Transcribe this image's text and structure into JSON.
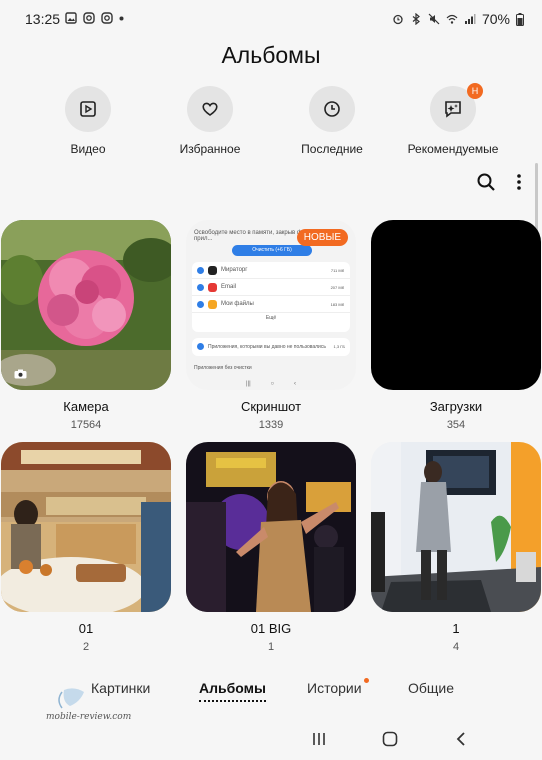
{
  "status_bar": {
    "time": "13:25",
    "battery": "70%"
  },
  "title": "Альбомы",
  "quick_access": [
    {
      "label": "Видео",
      "icon": "video-icon"
    },
    {
      "label": "Избранное",
      "icon": "heart-icon"
    },
    {
      "label": "Последние",
      "icon": "clock-icon"
    },
    {
      "label": "Рекомендуемые",
      "icon": "sparkle-chat-icon",
      "badge": "H"
    }
  ],
  "albums": [
    {
      "name": "Камера",
      "count": "17564"
    },
    {
      "name": "Скриншот",
      "count": "1339",
      "badge": "НОВЫЕ"
    },
    {
      "name": "Загрузки",
      "count": "354"
    },
    {
      "name": "01",
      "count": "2"
    },
    {
      "name": "01 BIG",
      "count": "1"
    },
    {
      "name": "1",
      "count": "4"
    }
  ],
  "screenshot_thumb": {
    "header": "Освободите место в памяти, закрыв фоновые прил...",
    "button": "Очистить (+6 ГБ)",
    "apps": [
      {
        "name": "Мираторг",
        "size": "711 Мб",
        "color": "#222222"
      },
      {
        "name": "Email",
        "size": "207 Мб",
        "color": "#e53935"
      },
      {
        "name": "Мои файлы",
        "size": "183 Мб",
        "color": "#f5a623"
      }
    ],
    "more": "Ещё",
    "unused_apps": "Приложения, которыми вы давно не пользовались",
    "unused_size": "1,3 ГБ",
    "no_clean": "Приложения без очистки"
  },
  "tabs": [
    {
      "label": "Картинки",
      "active": false
    },
    {
      "label": "Альбомы",
      "active": true
    },
    {
      "label": "Истории",
      "active": false,
      "dot": true
    },
    {
      "label": "Общие",
      "active": false
    }
  ],
  "watermark": "mobile-review.com",
  "colors": {
    "accent": "#f26a21",
    "background": "#f6f6f6"
  }
}
